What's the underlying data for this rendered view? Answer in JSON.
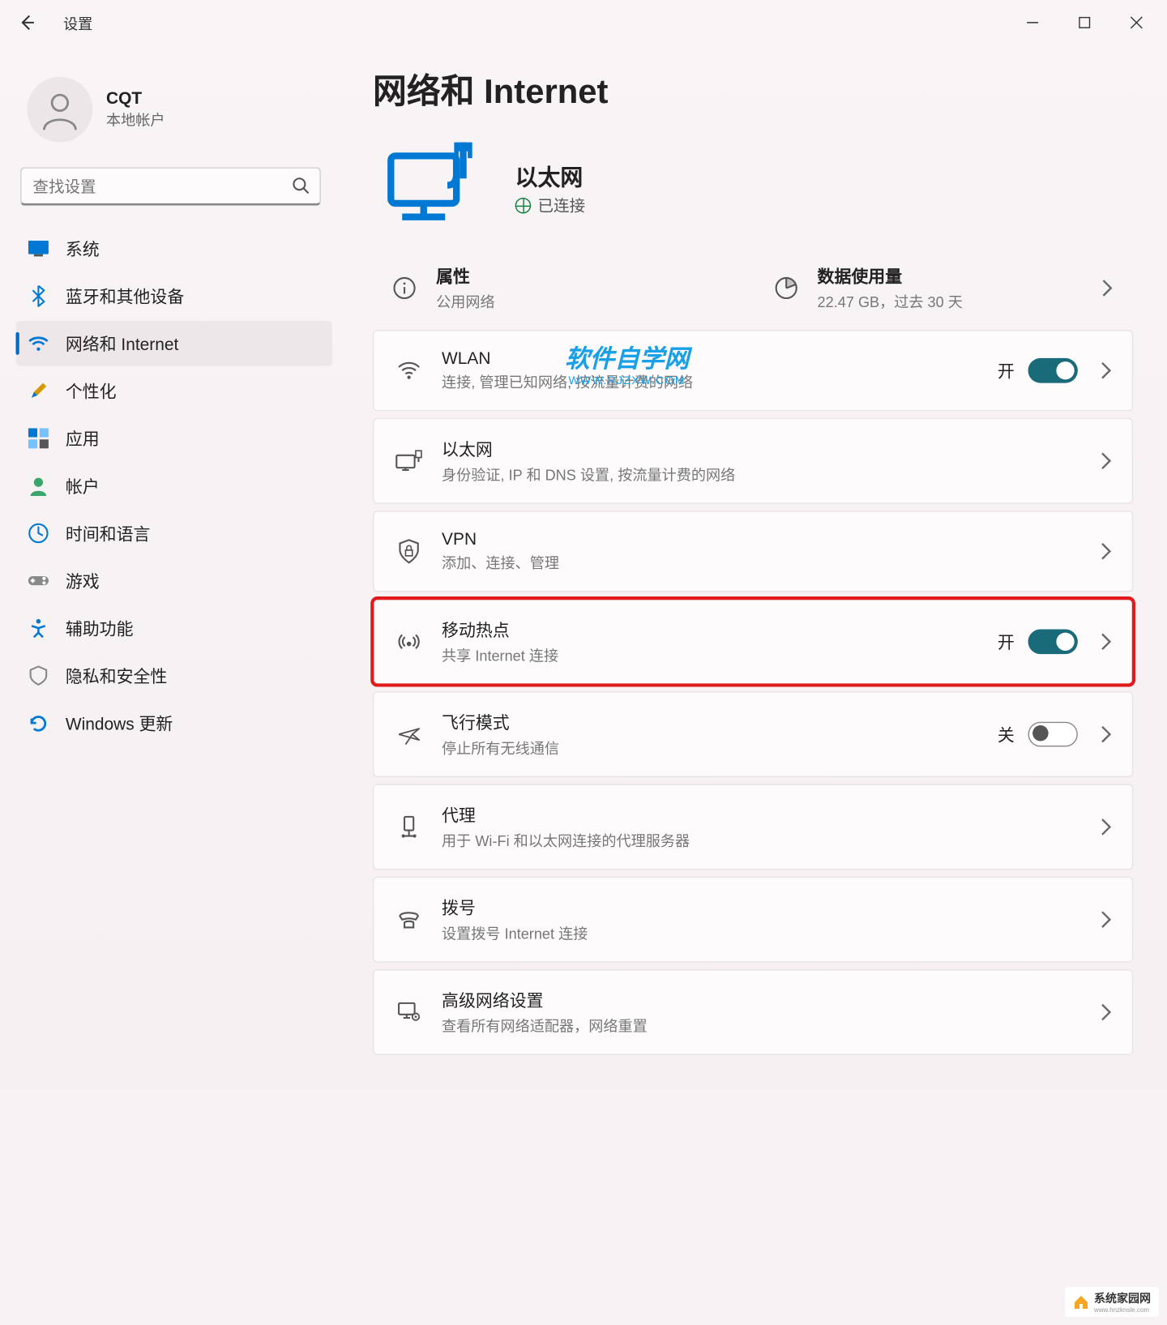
{
  "window": {
    "title": "设置"
  },
  "user": {
    "name": "CQT",
    "subtitle": "本地帐户"
  },
  "search": {
    "placeholder": "查找设置"
  },
  "nav": {
    "items": [
      {
        "label": "系统"
      },
      {
        "label": "蓝牙和其他设备"
      },
      {
        "label": "网络和 Internet"
      },
      {
        "label": "个性化"
      },
      {
        "label": "应用"
      },
      {
        "label": "帐户"
      },
      {
        "label": "时间和语言"
      },
      {
        "label": "游戏"
      },
      {
        "label": "辅助功能"
      },
      {
        "label": "隐私和安全性"
      },
      {
        "label": "Windows 更新"
      }
    ],
    "active_index": 2
  },
  "page": {
    "title": "网络和 Internet",
    "status": {
      "name": "以太网",
      "state": "已连接"
    },
    "tiles": {
      "properties": {
        "title": "属性",
        "subtitle": "公用网络"
      },
      "usage": {
        "title": "数据使用量",
        "subtitle": "22.47 GB，过去 30 天"
      }
    },
    "watermark": {
      "main": "软件自学网",
      "sub": "WWW.RJZXW.COM"
    },
    "items": [
      {
        "id": "wlan",
        "title": "WLAN",
        "subtitle": "连接, 管理已知网络, 按流量计费的网络",
        "toggle": {
          "state": "on",
          "label": "开"
        }
      },
      {
        "id": "ethernet",
        "title": "以太网",
        "subtitle": "身份验证, IP 和 DNS 设置, 按流量计费的网络"
      },
      {
        "id": "vpn",
        "title": "VPN",
        "subtitle": "添加、连接、管理"
      },
      {
        "id": "hotspot",
        "title": "移动热点",
        "subtitle": "共享 Internet 连接",
        "toggle": {
          "state": "on",
          "label": "开"
        },
        "highlight": true
      },
      {
        "id": "airplane",
        "title": "飞行模式",
        "subtitle": "停止所有无线通信",
        "toggle": {
          "state": "off",
          "label": "关"
        }
      },
      {
        "id": "proxy",
        "title": "代理",
        "subtitle": "用于 Wi-Fi 和以太网连接的代理服务器"
      },
      {
        "id": "dialup",
        "title": "拨号",
        "subtitle": "设置拨号 Internet 连接"
      },
      {
        "id": "advanced",
        "title": "高级网络设置",
        "subtitle": "查看所有网络适配器，网络重置"
      }
    ]
  },
  "footer": {
    "logo_text": "系统家园网",
    "logo_sub": "www.hnzknsle.com"
  }
}
